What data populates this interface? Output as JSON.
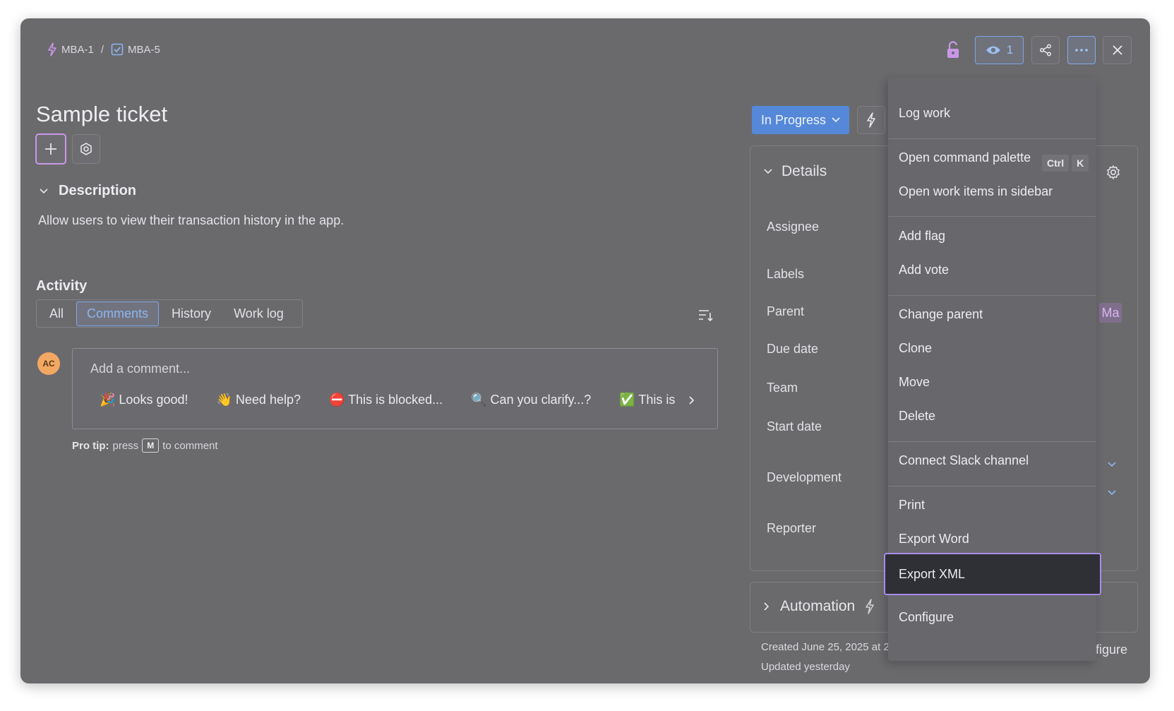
{
  "breadcrumb": {
    "parent": "MBA-1",
    "separator": "/",
    "current": "MBA-5"
  },
  "title": "Sample ticket",
  "description": {
    "heading": "Description",
    "text": "Allow users to view their transaction history in the app."
  },
  "activity": {
    "heading": "Activity",
    "tabs": [
      "All",
      "Comments",
      "History",
      "Work log"
    ],
    "active_tab": "Comments"
  },
  "comment": {
    "avatar_initials": "AC",
    "placeholder": "Add a comment...",
    "quick_replies": [
      "🎉 Looks good!",
      "👋 Need help?",
      "⛔ This is blocked...",
      "🔍 Can you clarify...?",
      "✅ This is on track"
    ],
    "protip_label": "Pro tip:",
    "protip_pre": "press",
    "protip_key": "M",
    "protip_post": "to comment"
  },
  "header": {
    "watch_count": "1"
  },
  "status": {
    "label": "In Progress"
  },
  "details": {
    "heading": "Details",
    "fields": [
      "Assignee",
      "Labels",
      "Parent",
      "Due date",
      "Team",
      "Start date",
      "Development",
      "Reporter"
    ],
    "parent_badge": "Ma"
  },
  "automation": {
    "heading": "Automation"
  },
  "footer": {
    "created": "Created June 25, 2025 at 2",
    "updated": "Updated yesterday",
    "configure_partial": "figure"
  },
  "menu": {
    "items": {
      "log_work": "Log work",
      "command_palette": "Open command palette",
      "command_palette_keys": [
        "Ctrl",
        "K"
      ],
      "open_sidebar": "Open work items in sidebar",
      "add_flag": "Add flag",
      "add_vote": "Add vote",
      "change_parent": "Change parent",
      "clone": "Clone",
      "move": "Move",
      "delete": "Delete",
      "connect_slack": "Connect Slack channel",
      "print": "Print",
      "export_word": "Export Word",
      "export_xml": "Export XML",
      "configure": "Configure"
    },
    "highlighted": "Export XML"
  },
  "colors": {
    "overlay": "#6a6a6d",
    "accent_blue": "#5588d8",
    "highlight_border": "#a98be9",
    "epic_purple": "#c997e8",
    "task_blue": "#8fb4ef",
    "avatar_orange": "#f3a862"
  },
  "icons": [
    "lightning-icon",
    "checkbox-icon",
    "plus-icon",
    "gear-icon",
    "chevron-down-icon",
    "sort-icon",
    "lock-open-icon",
    "eye-icon",
    "share-icon",
    "more-icon",
    "close-icon",
    "chevron-right-icon"
  ]
}
